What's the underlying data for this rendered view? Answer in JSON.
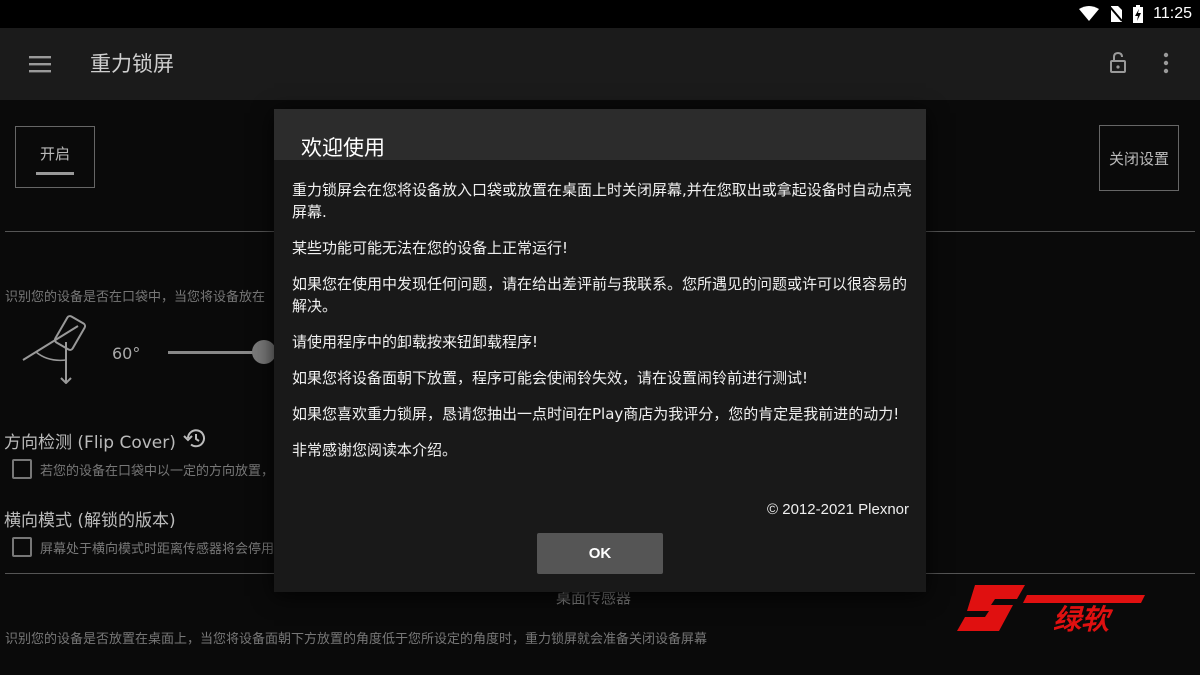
{
  "status_bar": {
    "time": "11:25"
  },
  "app_bar": {
    "title": "重力锁屏"
  },
  "main": {
    "switch_label": "开启",
    "close_settings_label": "关闭设置",
    "pocket_desc": "识别您的设备是否在口袋中，当您将设备放在",
    "angle_value": "60°",
    "flip_cover_title": "方向检测 (Flip Cover)",
    "flip_cover_desc": "若您的设备在口袋中以一定的方向放置，",
    "landscape_title": "横向模式 (解锁的版本)",
    "landscape_desc": "屏幕处于横向模式时距离传感器将会停用",
    "desk_sensor_label": "桌面传感器",
    "desk_desc": "识别您的设备是否放置在桌面上，当您将设备面朝下方放置的角度低于您所设定的角度时，重力锁屏就会准备关闭设备屏幕"
  },
  "dialog": {
    "title": "欢迎使用",
    "paragraphs": [
      "重力锁屏会在您将设备放入口袋或放置在桌面上时关闭屏幕,并在您取出或拿起设备时自动点亮屏幕.",
      "某些功能可能无法在您的设备上正常运行!",
      "如果您在使用中发现任何问题，请在给出差评前与我联系。您所遇见的问题或许可以很容易的解决。",
      "请使用程序中的卸载按来钮卸载程序!",
      "如果您将设备面朝下放置，程序可能会使闹铃失效，请在设置闹铃前进行测试!",
      "如果您喜欢重力锁屏，恳请您抽出一点时间在Play商店为我评分，您的肯定是我前进的动力!",
      "非常感谢您阅读本介绍。"
    ],
    "copyright": "© 2012-2021 Plexnor",
    "ok_label": "OK"
  },
  "watermark": {
    "text": "绿软"
  },
  "icons": [
    "wifi-icon",
    "no-sim-icon",
    "battery-charging-icon",
    "menu-icon",
    "lock-open-icon",
    "more-vert-icon",
    "restore-icon",
    "phone-angle-icon"
  ],
  "colors": {
    "app_bar": "#1b1b1b",
    "dialog": "#191919",
    "dialog_header": "#2c2c2c",
    "ok_button": "#555555",
    "watermark_red": "#e01010"
  }
}
